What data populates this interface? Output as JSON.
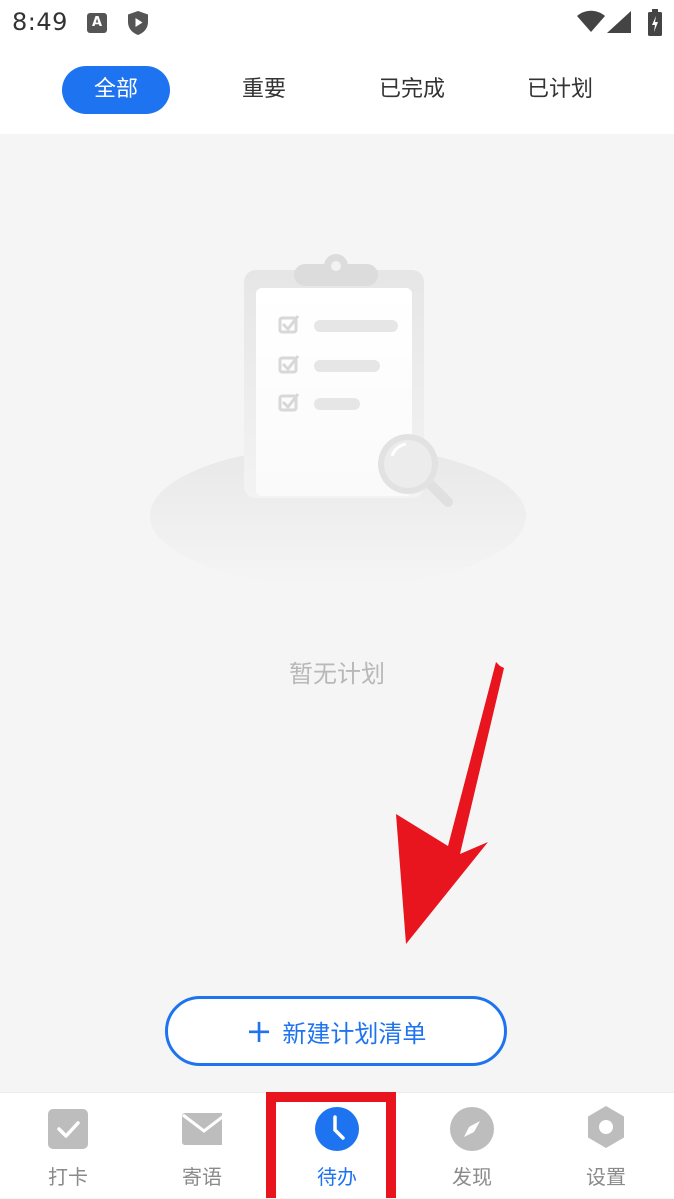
{
  "status_bar": {
    "time": "8:49",
    "icons": [
      "a-badge-icon",
      "shield-icon",
      "wifi-icon",
      "signal-icon",
      "battery-icon"
    ],
    "a_badge_text": "A"
  },
  "tabs": [
    {
      "label": "全部",
      "active": true
    },
    {
      "label": "重要",
      "active": false
    },
    {
      "label": "已完成",
      "active": false
    },
    {
      "label": "已计划",
      "active": false
    }
  ],
  "empty_state": {
    "icon": "clipboard-magnifier-illustration",
    "text": "暂无计划"
  },
  "new_list_button": {
    "icon": "plus-icon",
    "label": "新建计划清单"
  },
  "annotation": {
    "arrow_color": "#e8141e",
    "highlight_color": "#e8141e"
  },
  "bottom_nav": [
    {
      "label": "打卡",
      "icon": "checkbox-icon",
      "active": false
    },
    {
      "label": "寄语",
      "icon": "envelope-icon",
      "active": false
    },
    {
      "label": "待办",
      "icon": "clock-icon",
      "active": true
    },
    {
      "label": "发现",
      "icon": "compass-icon",
      "active": false
    },
    {
      "label": "设置",
      "icon": "settings-hexagon-icon",
      "active": false
    }
  ],
  "colors": {
    "accent": "#1e73f0",
    "inactive": "#8a8a8a",
    "background": "#f5f5f5"
  }
}
